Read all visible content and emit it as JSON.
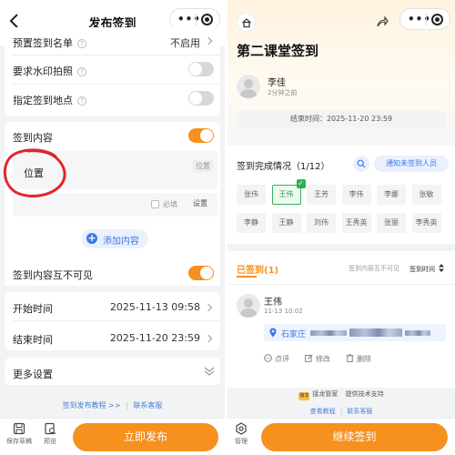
{
  "left": {
    "header": {
      "title": "发布签到"
    },
    "settings": {
      "preset_list": {
        "label": "预置签到名单",
        "value": "不启用"
      },
      "watermark": {
        "label": "要求水印拍照",
        "enabled": false
      },
      "location": {
        "label": "指定签到地点",
        "enabled": false
      }
    },
    "content": {
      "label": "签到内容",
      "enabled": true,
      "field_name": "位置",
      "field_type": "位置",
      "required_label": "必填",
      "setting_label": "设置",
      "add_label": "添加内容"
    },
    "invisible": {
      "label": "签到内容互不可见",
      "enabled": true
    },
    "times": {
      "start_label": "开始时间",
      "start_value": "2025-11-13 09:58",
      "end_label": "结束时间",
      "end_value": "2025-11-20 23:59"
    },
    "more": {
      "label": "更多设置"
    },
    "links": {
      "tutorial": "签到发布教程 >>",
      "sep": "|",
      "support": "联系客服"
    },
    "bottom": {
      "draft_label": "保存草稿",
      "preview_label": "预览",
      "publish_label": "立即发布"
    },
    "colors": {
      "accent": "#f6901e",
      "link": "#4a7fd4",
      "annotation": "#e0262b"
    }
  },
  "right": {
    "title": "第二课堂签到",
    "publisher": {
      "name": "李佳",
      "time": "2分钟之前"
    },
    "end_time_label": "结束时间：",
    "end_time_value": "2025-11-20 23:59",
    "completion": {
      "label": "签到完成情况（1/12）",
      "notify_label": "通知未签到人员",
      "names": [
        "张伟",
        "王伟",
        "王芳",
        "李伟",
        "李娜",
        "张敏",
        "李静",
        "王静",
        "刘伟",
        "王秀英",
        "张丽",
        "李秀英"
      ],
      "signed_index": 1
    },
    "signed_tab": {
      "label": "已签到",
      "count": "(1)",
      "hint": "签到内容互不可见",
      "sort_label": "签到时间"
    },
    "record": {
      "name": "王伟",
      "time": "11-13 10:02",
      "location_prefix": "石家庄",
      "actions": {
        "comment": "点评",
        "edit": "修改",
        "delete": "删除"
      }
    },
    "footer": {
      "brand": "接龙管家",
      "brand_logo": "接龙",
      "tech": "提供技术支持",
      "tutorial": "查看教程",
      "sep": "|",
      "support": "联系客服"
    },
    "bottom": {
      "manage_label": "管理",
      "continue_label": "继续签到"
    }
  }
}
